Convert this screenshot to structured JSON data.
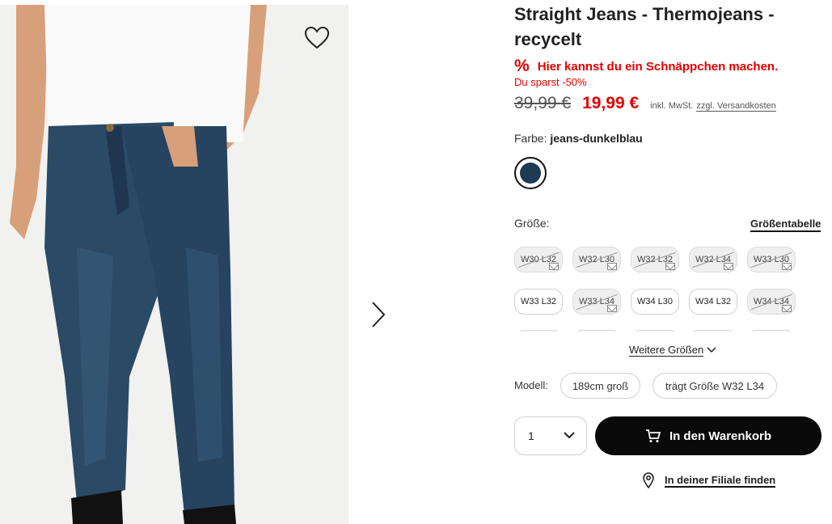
{
  "product": {
    "title": "Straight Jeans - Thermojeans - recycelt",
    "deal_text": "Hier kannst du ein Schnäppchen machen.",
    "deal_icon": "%",
    "savings": "Du sparst -50%",
    "old_price": "39,99 €",
    "new_price": "19,99 €",
    "tax_note": "inkl. MwSt.",
    "shipping_link": "zzgl. Versandkosten"
  },
  "color": {
    "label": "Farbe:",
    "value": "jeans-dunkelblau",
    "swatch_hex": "#1f3a55"
  },
  "size": {
    "label": "Größe:",
    "table_link": "Größentabelle",
    "options": [
      {
        "label": "W30 L32",
        "available": false
      },
      {
        "label": "W32 L30",
        "available": false
      },
      {
        "label": "W32 L32",
        "available": false
      },
      {
        "label": "W32 L34",
        "available": false
      },
      {
        "label": "W33 L30",
        "available": false
      },
      {
        "label": "W33 L32",
        "available": true
      },
      {
        "label": "W33 L34",
        "available": false
      },
      {
        "label": "W34 L30",
        "available": true
      },
      {
        "label": "W34 L32",
        "available": true
      },
      {
        "label": "W34 L34",
        "available": false
      }
    ],
    "more_label": "Weitere Größen"
  },
  "model": {
    "label": "Modell:",
    "height": "189cm groß",
    "wears": "trägt Größe W32 L34"
  },
  "purchase": {
    "quantity": "1",
    "cart_button": "In den Warenkorb",
    "store_link": "In deiner Filiale finden"
  },
  "colors": {
    "accent_red": "#e10000",
    "button_black": "#0a0a0a"
  }
}
